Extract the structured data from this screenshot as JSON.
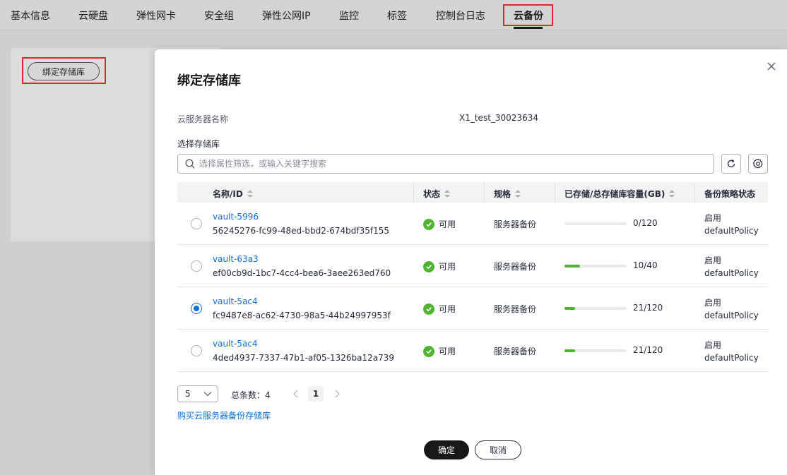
{
  "tabs": [
    {
      "label": "基本信息",
      "active": false
    },
    {
      "label": "云硬盘",
      "active": false
    },
    {
      "label": "弹性网卡",
      "active": false
    },
    {
      "label": "安全组",
      "active": false
    },
    {
      "label": "弹性公网IP",
      "active": false
    },
    {
      "label": "监控",
      "active": false
    },
    {
      "label": "标签",
      "active": false
    },
    {
      "label": "控制台日志",
      "active": false
    },
    {
      "label": "云备份",
      "active": true
    }
  ],
  "background": {
    "bind_button": "绑定存储库"
  },
  "dialog": {
    "title": "绑定存储库",
    "server_name_label": "云服务器名称",
    "server_name_value": "X1_test_30023634",
    "select_label": "选择存储库",
    "search_placeholder": "选择属性筛选，或输入关键字搜索",
    "columns": {
      "name": "名称/ID",
      "status": "状态",
      "spec": "规格",
      "capacity": "已存储/总存储库容量(GB)",
      "policy": "备份策略状态"
    },
    "rows": [
      {
        "name": "vault-5996",
        "id": "56245276-fc99-48ed-bbd2-674bdf35f155",
        "status": "可用",
        "spec": "服务器备份",
        "capacity": "0/120",
        "usage": 0.0,
        "policy_state": "启用",
        "policy_name": "defaultPolicy",
        "selected": false
      },
      {
        "name": "vault-63a3",
        "id": "ef00cb9d-1bc7-4cc4-bea6-3aee263ed760",
        "status": "可用",
        "spec": "服务器备份",
        "capacity": "10/40",
        "usage": 0.25,
        "policy_state": "启用",
        "policy_name": "defaultPolicy",
        "selected": false
      },
      {
        "name": "vault-5ac4",
        "id": "fc9487e8-ac62-4730-98a5-44b24997953f",
        "status": "可用",
        "spec": "服务器备份",
        "capacity": "21/120",
        "usage": 0.175,
        "policy_state": "启用",
        "policy_name": "defaultPolicy",
        "selected": true
      },
      {
        "name": "vault-5ac4",
        "id": "4ded4937-7337-47b1-af05-1326ba12a739",
        "status": "可用",
        "spec": "服务器备份",
        "capacity": "21/120",
        "usage": 0.175,
        "policy_state": "启用",
        "policy_name": "defaultPolicy",
        "selected": false
      }
    ],
    "pagination": {
      "page_size": "5",
      "total": "总条数：4",
      "current_page": "1"
    },
    "buy_link": "购买云服务器备份存储库",
    "confirm": "确定",
    "cancel": "取消"
  },
  "colors": {
    "accent": "#0d6fde",
    "success": "#50b331",
    "highlight": "#e4232a"
  }
}
